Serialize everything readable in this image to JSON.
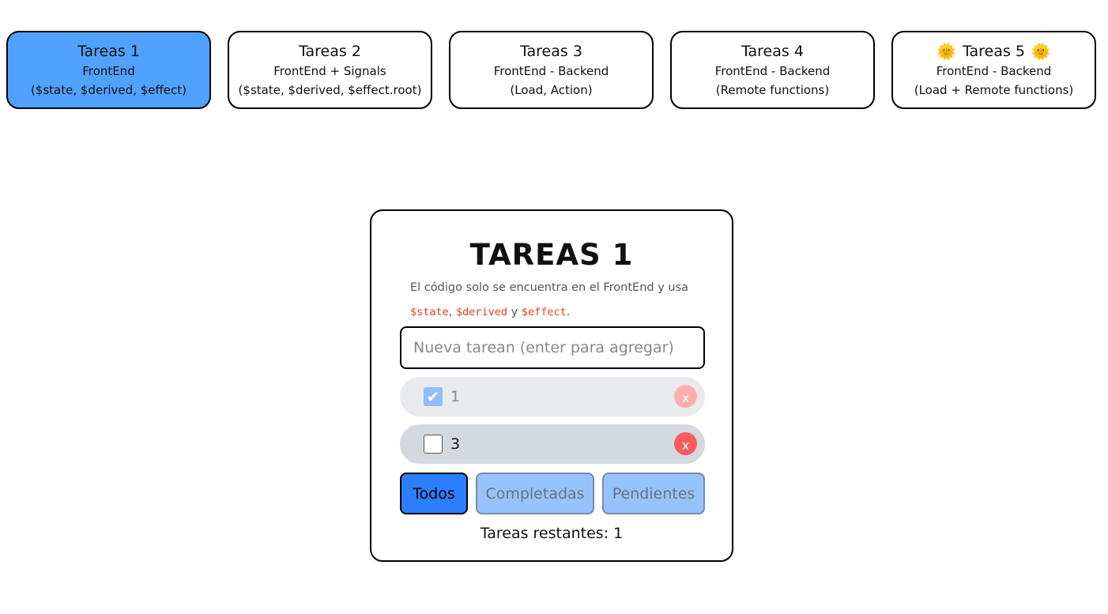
{
  "nav": [
    {
      "title": "Tareas 1",
      "line1": "FrontEnd",
      "line2": "($state, $derived, $effect)",
      "active": true
    },
    {
      "title": "Tareas 2",
      "line1": "FrontEnd + Signals",
      "line2": "($state, $derived, $effect.root)",
      "active": false
    },
    {
      "title": "Tareas 3",
      "line1": "FrontEnd - Backend",
      "line2": "(Load, Action)",
      "active": false
    },
    {
      "title": "Tareas 4",
      "line1": "FrontEnd - Backend",
      "line2": "(Remote functions)",
      "active": false
    },
    {
      "title": "Tareas 5",
      "line1": "FrontEnd - Backend",
      "line2": "(Load + Remote functions)",
      "active": false,
      "sun": "🌞"
    }
  ],
  "panel": {
    "title": "TAREAS 1",
    "desc_prefix": "El código solo se encuentra en el FrontEnd y usa",
    "code1": "$state",
    "sep1": ", ",
    "code2": "$derived",
    "sep2": " y ",
    "code3": "$effect",
    "sep3": ".",
    "input_placeholder": "Nueva tarean (enter para agregar)",
    "tasks": [
      {
        "label": "1",
        "done": true,
        "delete_label": "x"
      },
      {
        "label": "3",
        "done": false,
        "delete_label": "x"
      }
    ],
    "filters": [
      "Todos",
      "Completadas",
      "Pendientes"
    ],
    "active_filter": "Todos",
    "remaining": "Tareas restantes: 1"
  },
  "colors": {
    "active_nav": "#51a2ff",
    "code": "#e0421a",
    "active_filter": "#2b7fff",
    "inactive_filter": "#97c3fd",
    "delete_strong": "#fb5b5b",
    "delete_faded": "#ffadad"
  }
}
